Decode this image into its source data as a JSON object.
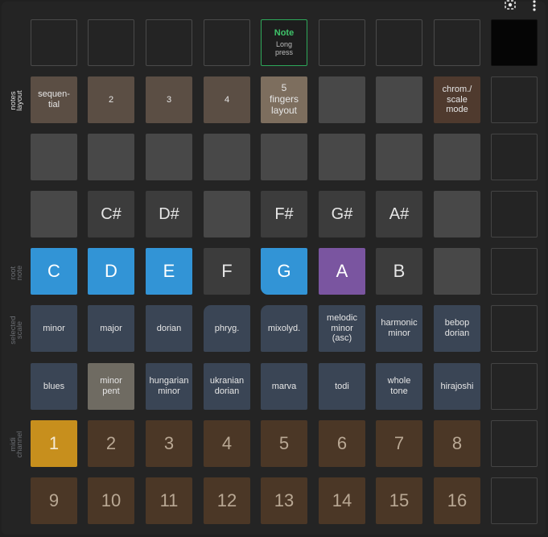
{
  "top_icons": {
    "lens": "lens-icon",
    "menu": "more-vert-icon"
  },
  "row_labels": {
    "notes_layout": "notes\nlayout",
    "root_note": "root\nnote",
    "selected_scale": "selected\nscale",
    "midi_channel": "midi\nchannel"
  },
  "note_button": {
    "title": "Note",
    "subtitle": "Long\npress"
  },
  "layout_row": [
    "sequen-\ntial",
    "2",
    "3",
    "4",
    "5\nfingers\nlayout",
    "",
    "",
    "chrom./\nscale\nmode"
  ],
  "sharps_row": [
    "",
    "C#",
    "D#",
    "",
    "F#",
    "G#",
    "A#",
    ""
  ],
  "root_notes": [
    "C",
    "D",
    "E",
    "F",
    "G",
    "A",
    "B",
    ""
  ],
  "selected_root": "A",
  "scales_row1": [
    "minor",
    "major",
    "dorian",
    "phryg.",
    "mixolyd.",
    "melodic\nminor\n(asc)",
    "harmonic\nminor",
    "bebop\ndorian"
  ],
  "scales_row2": [
    "blues",
    "minor\npent",
    "hungarian\nminor",
    "ukranian\ndorian",
    "marva",
    "todi",
    "whole\ntone",
    "hirajoshi"
  ],
  "selected_scale": "minor pent",
  "midi_row1": [
    "1",
    "2",
    "3",
    "4",
    "5",
    "6",
    "7",
    "8"
  ],
  "midi_row2": [
    "9",
    "10",
    "11",
    "12",
    "13",
    "14",
    "15",
    "16"
  ],
  "selected_channel": "1",
  "colors": {
    "accent_green": "#3fc46a",
    "root_blue": "#3294d6",
    "root_selected_purple": "#7a55a0",
    "scale_blue": "#3a4555",
    "midi_brown": "#4b3726",
    "midi_selected": "#c78f1d"
  }
}
